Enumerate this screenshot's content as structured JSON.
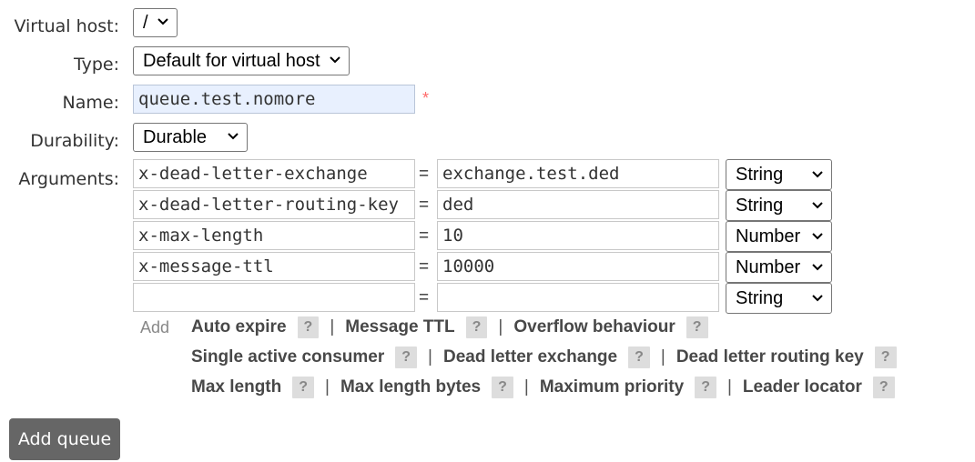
{
  "form": {
    "vhost_label": "Virtual host:",
    "vhost_value": "/",
    "type_label": "Type:",
    "type_value": "Default for virtual host",
    "name_label": "Name:",
    "name_value": "queue.test.nomore",
    "required_mark": "*",
    "durability_label": "Durability:",
    "durability_value": "Durable",
    "arguments_label": "Arguments:"
  },
  "arguments": [
    {
      "key": "x-dead-letter-exchange",
      "value": "exchange.test.ded",
      "type": "String"
    },
    {
      "key": "x-dead-letter-routing-key",
      "value": "ded",
      "type": "String"
    },
    {
      "key": "x-max-length",
      "value": "10",
      "type": "Number"
    },
    {
      "key": "x-message-ttl",
      "value": "10000",
      "type": "Number"
    },
    {
      "key": "",
      "value": "",
      "type": "String"
    }
  ],
  "equals": "=",
  "add_label": "Add",
  "help_glyph": "?",
  "separator": "|",
  "suggestions": {
    "auto_expire": "Auto expire",
    "message_ttl": "Message TTL",
    "overflow_behaviour": "Overflow behaviour",
    "single_active_consumer": "Single active consumer",
    "dead_letter_exchange": "Dead letter exchange",
    "dead_letter_routing_key": "Dead letter routing key",
    "max_length": "Max length",
    "max_length_bytes": "Max length bytes",
    "maximum_priority": "Maximum priority",
    "leader_locator": "Leader locator"
  },
  "submit_label": "Add queue"
}
